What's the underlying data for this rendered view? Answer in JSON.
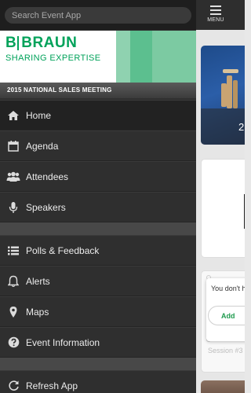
{
  "search": {
    "placeholder": "Search Event App"
  },
  "logo": {
    "brand_left": "B",
    "brand_right": "BRAUN",
    "tagline": "SHARING EXPERTISE"
  },
  "event": {
    "title": "2015 NATIONAL SALES MEETING"
  },
  "menu": {
    "group1": [
      {
        "label": "Home",
        "icon": "home-icon",
        "active": true
      },
      {
        "label": "Agenda",
        "icon": "calendar-icon"
      },
      {
        "label": "Attendees",
        "icon": "users-icon"
      },
      {
        "label": "Speakers",
        "icon": "microphone-icon"
      }
    ],
    "group2": [
      {
        "label": "Polls & Feedback",
        "icon": "list-icon"
      },
      {
        "label": "Alerts",
        "icon": "bell-icon"
      },
      {
        "label": "Maps",
        "icon": "map-pin-icon"
      },
      {
        "label": "Event Information",
        "icon": "question-icon"
      }
    ],
    "group3": [
      {
        "label": "Refresh App",
        "icon": "refresh-icon"
      }
    ]
  },
  "topbar": {
    "menu_label": "MENU"
  },
  "cards": {
    "card1_number": "2",
    "popup_text": "You don't h",
    "add_button": "Add",
    "session": "Session #3"
  },
  "colors": {
    "brand_green": "#00a25a",
    "sidebar_bg": "#2f2f2f",
    "accent_add": "#1f9b4e"
  }
}
